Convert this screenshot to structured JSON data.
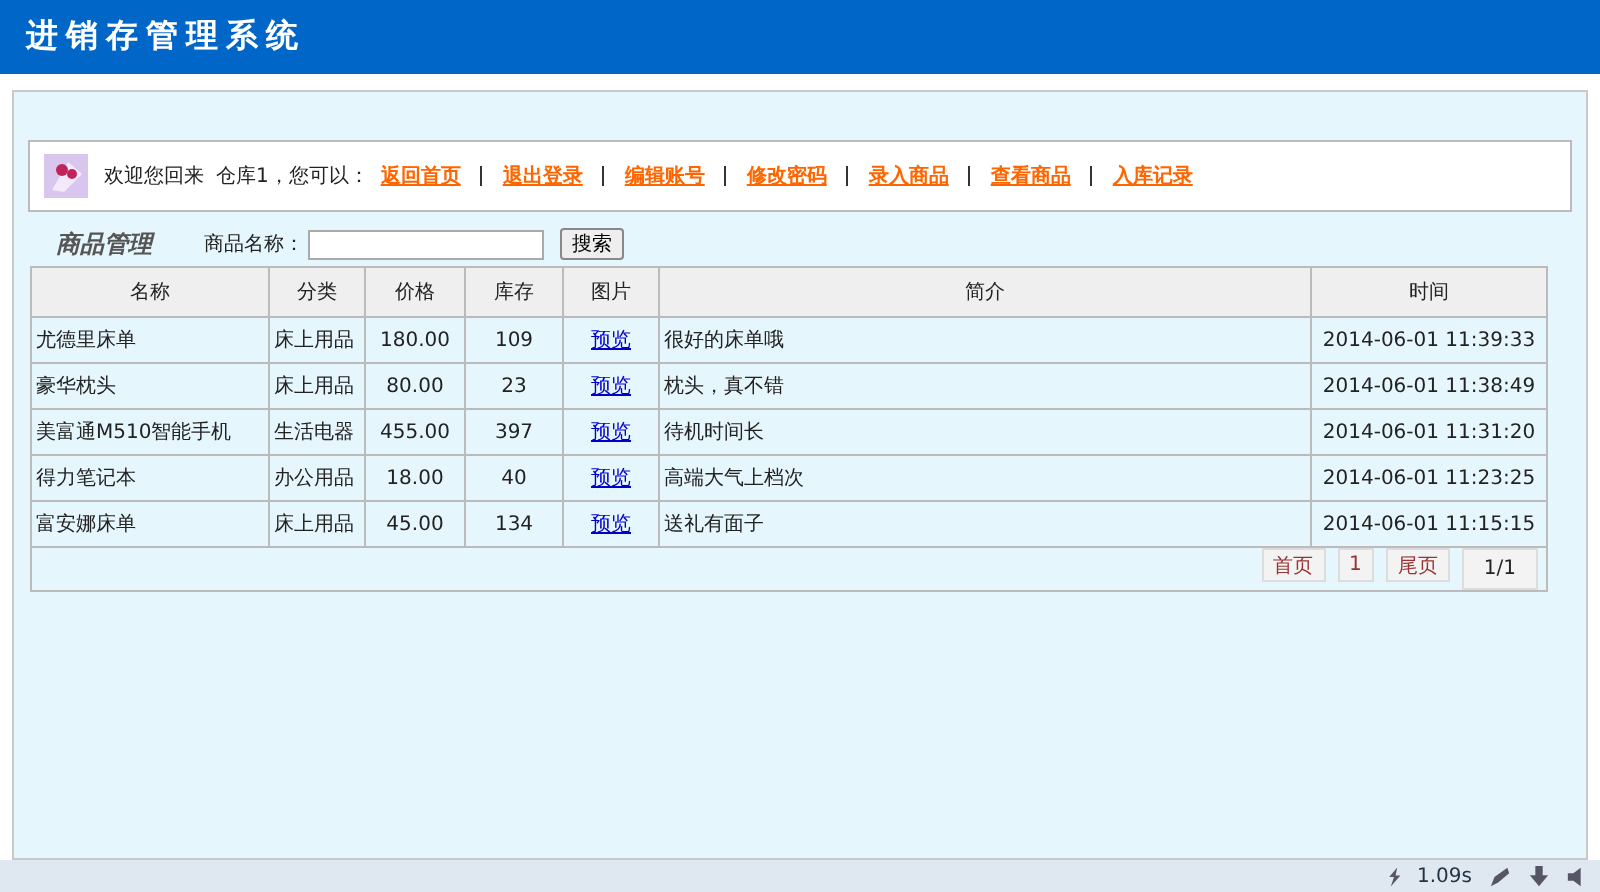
{
  "header": {
    "title": "进销存管理系统"
  },
  "welcome": {
    "greeting": "欢迎您回来",
    "user": "仓库1，您可以：",
    "links": [
      "返回首页",
      "退出登录",
      "编辑账号",
      "修改密码",
      "录入商品",
      "查看商品",
      "入库记录"
    ]
  },
  "section": {
    "title": "商品管理",
    "search_label": "商品名称：",
    "search_button": "搜索"
  },
  "table": {
    "columns": [
      "名称",
      "分类",
      "价格",
      "库存",
      "图片",
      "简介",
      "时间"
    ],
    "rows": [
      {
        "name": "尤德里床单",
        "category": "床上用品",
        "price": "180.00",
        "stock": "109",
        "image": "预览",
        "intro": "很好的床单哦",
        "time": "2014-06-01 11:39:33"
      },
      {
        "name": "豪华枕头",
        "category": "床上用品",
        "price": "80.00",
        "stock": "23",
        "image": "预览",
        "intro": "枕头，真不错",
        "time": "2014-06-01 11:38:49"
      },
      {
        "name": "美富通M510智能手机",
        "category": "生活电器",
        "price": "455.00",
        "stock": "397",
        "image": "预览",
        "intro": "待机时间长",
        "time": "2014-06-01 11:31:20"
      },
      {
        "name": "得力笔记本",
        "category": "办公用品",
        "price": "18.00",
        "stock": "40",
        "image": "预览",
        "intro": "高端大气上档次",
        "time": "2014-06-01 11:23:25"
      },
      {
        "name": "富安娜床单",
        "category": "床上用品",
        "price": "45.00",
        "stock": "134",
        "image": "预览",
        "intro": "送礼有面子",
        "time": "2014-06-01 11:15:15"
      }
    ]
  },
  "pagination": {
    "first": "首页",
    "pages": [
      "1"
    ],
    "last": "尾页",
    "info": "1/1"
  },
  "status_bar": {
    "load_time": "1.09s"
  }
}
